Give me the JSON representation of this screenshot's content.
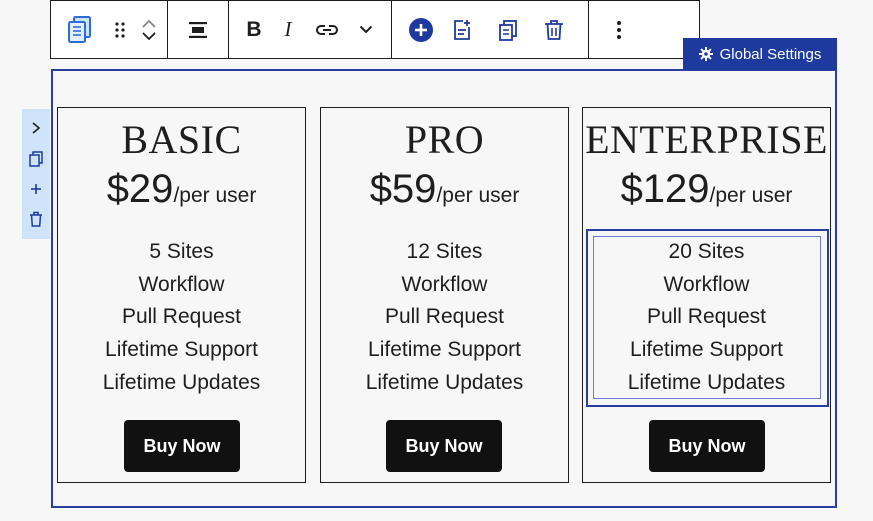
{
  "toolbar": {
    "icons": [
      "block-type-icon",
      "drag-handle-icon",
      "move-up-icon",
      "move-down-icon",
      "align-icon",
      "bold-icon",
      "italic-icon",
      "link-icon",
      "chevron-down-icon",
      "add-icon",
      "insert-after-icon",
      "duplicate-icon",
      "delete-icon",
      "more-options-icon"
    ],
    "bold_label": "B",
    "italic_label": "I",
    "accent_color": "#1f3a9e"
  },
  "global_settings": {
    "label": "Global Settings"
  },
  "side_tools": {
    "icons": [
      "expand-icon",
      "copy-icon",
      "add-icon",
      "delete-icon"
    ]
  },
  "plans": [
    {
      "name": "BASIC",
      "price": "$29",
      "per": "/per user",
      "features": [
        "5 Sites",
        "Workflow",
        "Pull Request",
        "Lifetime Support",
        "Lifetime Updates"
      ],
      "button": "Buy Now"
    },
    {
      "name": "PRO",
      "price": "$59",
      "per": "/per user",
      "features": [
        "12 Sites",
        "Workflow",
        "Pull Request",
        "Lifetime Support",
        "Lifetime Updates"
      ],
      "button": "Buy Now"
    },
    {
      "name": "ENTERPRISE",
      "price": "$129",
      "per": "/per user",
      "features": [
        "20 Sites",
        "Workflow",
        "Pull Request",
        "Lifetime Support",
        "Lifetime Updates"
      ],
      "button": "Buy Now"
    }
  ]
}
